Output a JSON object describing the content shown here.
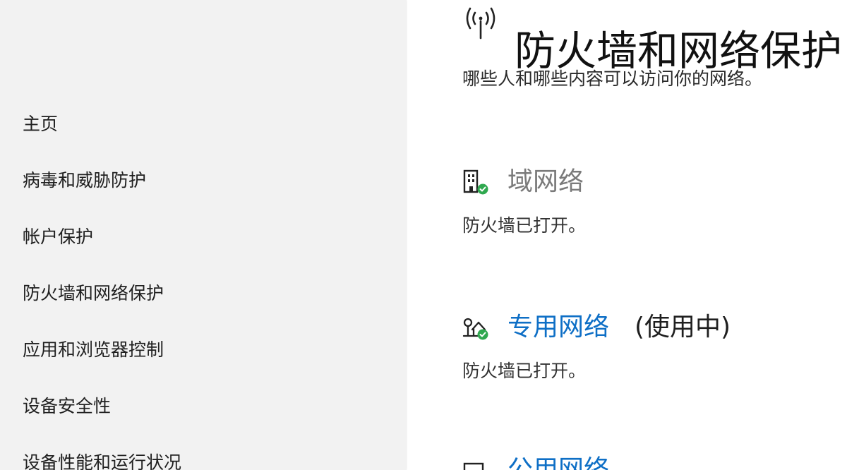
{
  "sidebar": {
    "items": [
      {
        "label": "主页"
      },
      {
        "label": "病毒和威胁防护"
      },
      {
        "label": "帐户保护"
      },
      {
        "label": "防火墙和网络保护"
      },
      {
        "label": "应用和浏览器控制"
      },
      {
        "label": "设备安全性"
      },
      {
        "label": "设备性能和运行状况"
      }
    ]
  },
  "header": {
    "icon": "wireless-antenna-icon",
    "title": "防火墙和网络保护",
    "subtitle": "哪些人和哪些内容可以访问你的网络。"
  },
  "networks": {
    "domain": {
      "icon": "domain-network-building-icon",
      "name": "域网络",
      "status": "防火墙已打开。"
    },
    "private": {
      "icon": "private-network-home-icon",
      "name": "专用网络",
      "suffix": "(使用中)",
      "status": "防火墙已打开。"
    },
    "public": {
      "icon": "public-network-bench-icon",
      "name": "公用网络"
    }
  },
  "colors": {
    "sidebar_bg": "#f2f2f2",
    "link": "#0e6fc6",
    "check": "#2fa84f",
    "disabled_text": "#7a7a7a"
  }
}
